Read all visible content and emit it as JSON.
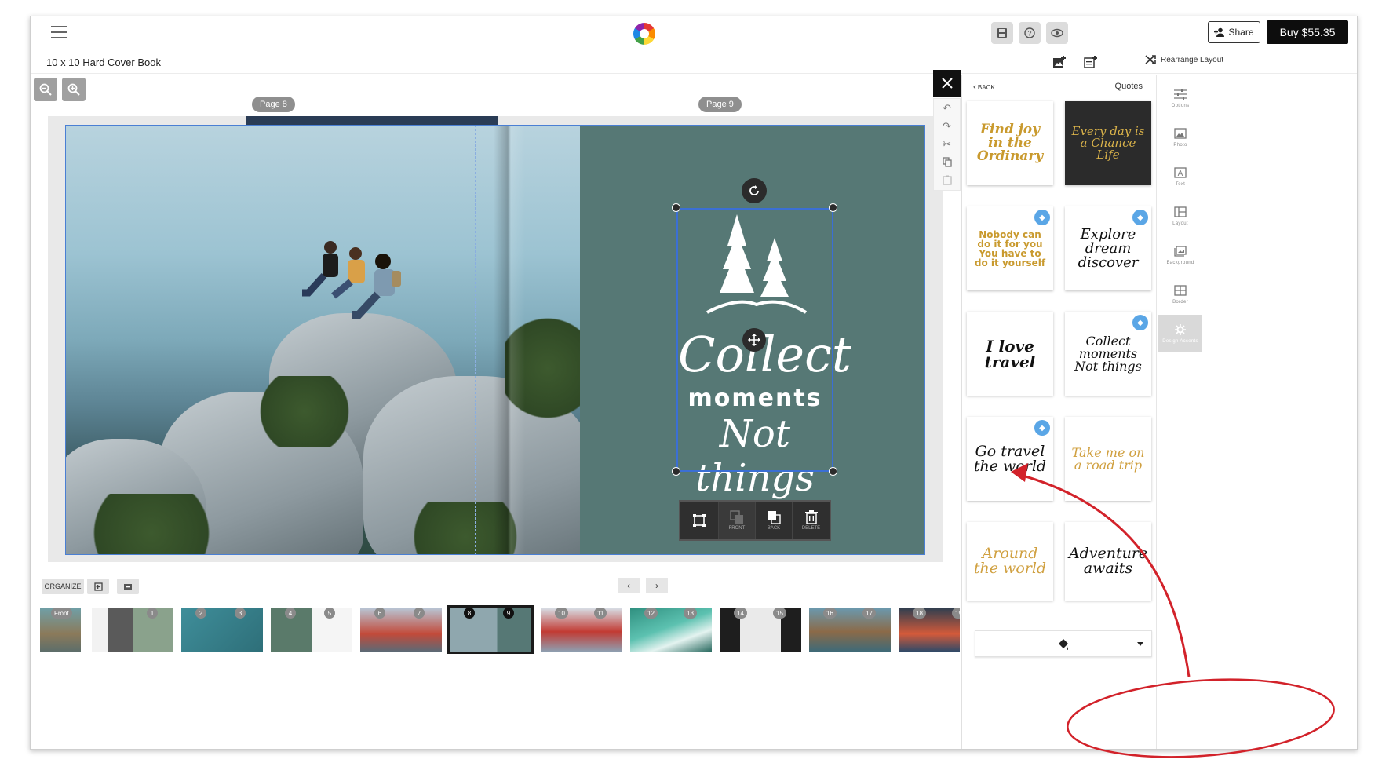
{
  "header": {
    "buy_label": "Buy $55.35",
    "share_label": "Share",
    "icons": [
      "save-icon",
      "help-icon",
      "preview-icon"
    ]
  },
  "subbar": {
    "book_title": "10 x 10 Hard Cover Book",
    "rearrange_label": "Rearrange Layout"
  },
  "editor": {
    "page_left_label": "Page 8",
    "page_right_label": "Page 9",
    "accent_text": {
      "line1": "Collect",
      "line2": "moments",
      "line3": "Not things"
    },
    "page_color": "#567875",
    "selection_color": "#3b6fd4",
    "toolbar": {
      "back_label": "BACK",
      "delete_label": "DELETE",
      "front_label": "FRONT"
    }
  },
  "organizer": {
    "organize_label": "ORGANIZE",
    "thumbs": [
      {
        "labels": [
          "Front"
        ]
      },
      {
        "labels": [
          "1"
        ]
      },
      {
        "labels": [
          "2",
          "3"
        ]
      },
      {
        "labels": [
          "4",
          "5"
        ]
      },
      {
        "labels": [
          "6",
          "7"
        ]
      },
      {
        "labels": [
          "8",
          "9"
        ],
        "selected": true
      },
      {
        "labels": [
          "10",
          "11"
        ]
      },
      {
        "labels": [
          "12",
          "13"
        ]
      },
      {
        "labels": [
          "14",
          "15"
        ]
      },
      {
        "labels": [
          "16",
          "17"
        ]
      },
      {
        "labels": [
          "18",
          "19"
        ]
      }
    ]
  },
  "panel": {
    "back_label": "BACK",
    "title": "Quotes",
    "cards": [
      {
        "text": "Find joy in the Ordinary"
      },
      {
        "text": "Every day is a Chance Life"
      },
      {
        "text": "Nobody can do it for you You have to do it yourself"
      },
      {
        "text": "Explore dream discover"
      },
      {
        "text": "I love travel"
      },
      {
        "text": "Collect moments Not things"
      },
      {
        "text": "Go travel the world"
      },
      {
        "text": "Take me on a road trip"
      },
      {
        "text": "Around the world"
      },
      {
        "text": "Adventure awaits"
      }
    ]
  },
  "sidebar": {
    "items": [
      {
        "label": "Options",
        "icon": "sliders-icon"
      },
      {
        "label": "Photo",
        "icon": "photo-icon"
      },
      {
        "label": "Text",
        "icon": "text-icon"
      },
      {
        "label": "Layout",
        "icon": "layout-icon"
      },
      {
        "label": "Background",
        "icon": "background-icon"
      },
      {
        "label": "Border",
        "icon": "border-icon"
      },
      {
        "label": "Design Accents",
        "icon": "gear-icon",
        "active": true
      }
    ]
  }
}
